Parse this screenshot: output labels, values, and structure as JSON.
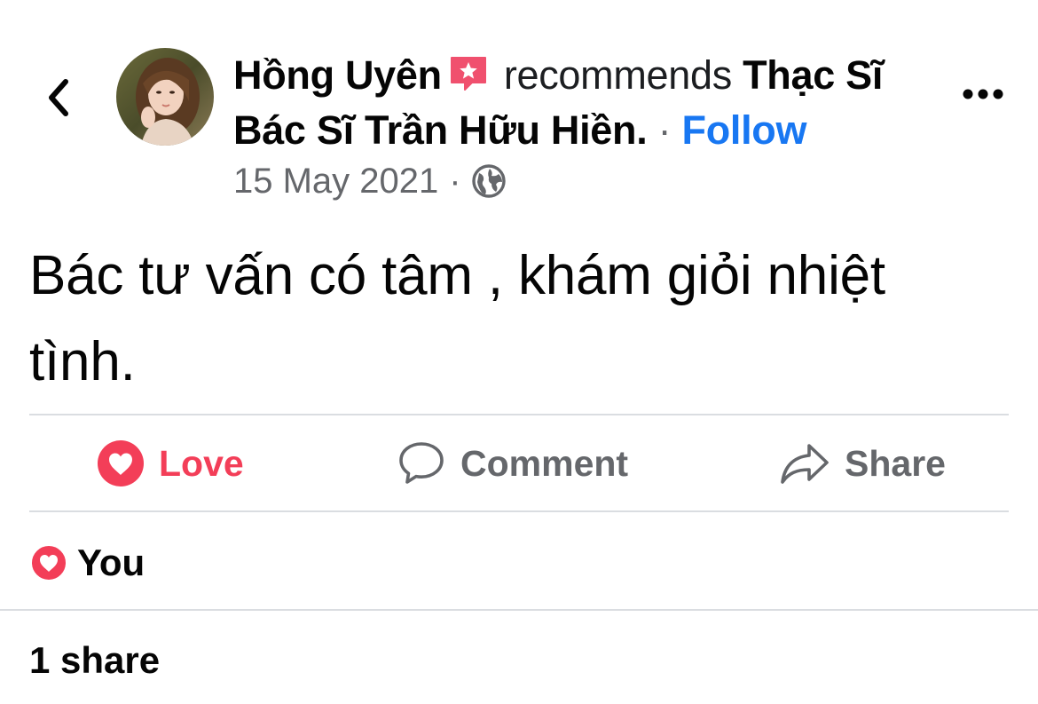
{
  "header": {
    "back_icon": "chevron-left-icon",
    "author_name": "Hồng Uyên",
    "badge_icon": "recommend-star-icon",
    "recommends_word": "recommends",
    "page_name": "Thạc Sĩ Bác Sĩ Trần Hữu Hiền.",
    "separator": "·",
    "follow_label": "Follow",
    "date": "15 May 2021",
    "audience_icon": "globe-icon",
    "more_icon": "more-horizontal-icon"
  },
  "post": {
    "text": "Bác tư vấn có tâm , khám giỏi nhiệt tình."
  },
  "actions": {
    "love_label": "Love",
    "comment_label": "Comment",
    "share_label": "Share"
  },
  "reactions": {
    "icon": "love-reaction-icon",
    "summary": "You"
  },
  "shares": {
    "count_text": "1 share"
  },
  "colors": {
    "love": "#f33e58",
    "follow": "#1877f2",
    "secondary_text": "#65676b",
    "divider": "#dadde1",
    "badge": "#f0506e"
  }
}
